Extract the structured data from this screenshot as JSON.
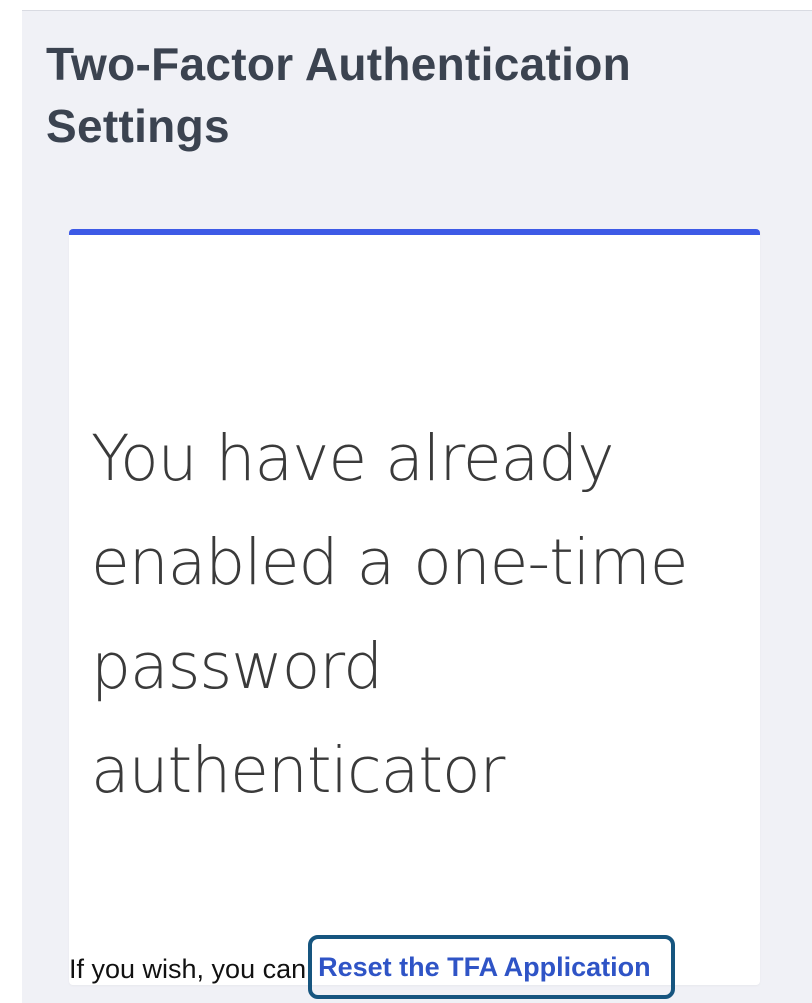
{
  "page": {
    "title": "Two-Factor Authentication Settings"
  },
  "card": {
    "message": "You have already enabled a one-time password authenticator",
    "reset_prefix": "If you wish, you can",
    "reset_link_label": "Reset the TFA Application"
  },
  "colors": {
    "accent": "#3d5ae6",
    "link": "#2f54c6",
    "focus_outline": "#16557f",
    "page_background": "#f0f1f6"
  }
}
